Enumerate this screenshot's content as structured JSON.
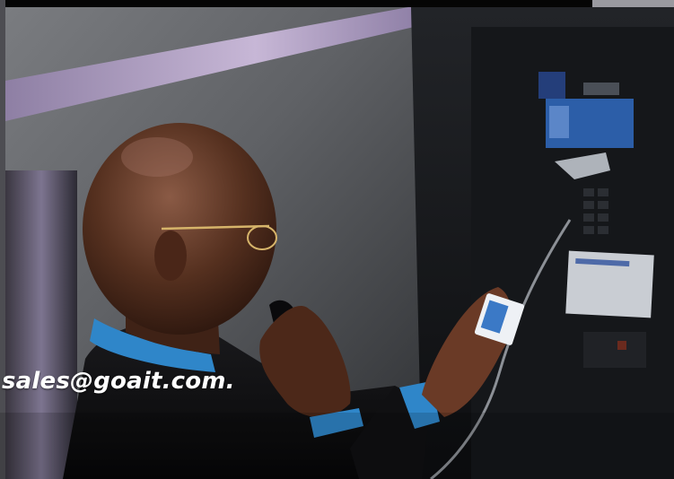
{
  "contact": {
    "email": "sales@goait.com."
  },
  "scene": {
    "subject": "man-on-payphone",
    "colors": {
      "background": "#0a0a0a",
      "wall_steel": "#6d6f73",
      "phone_panel": "#1b1d21",
      "shirt_blue": "#2f86c9",
      "skin": "#5a3526",
      "card_blue": "#3b79c6",
      "sign_blue": "#2c5ea8",
      "frame_lilac": "#b6a5c7"
    }
  }
}
